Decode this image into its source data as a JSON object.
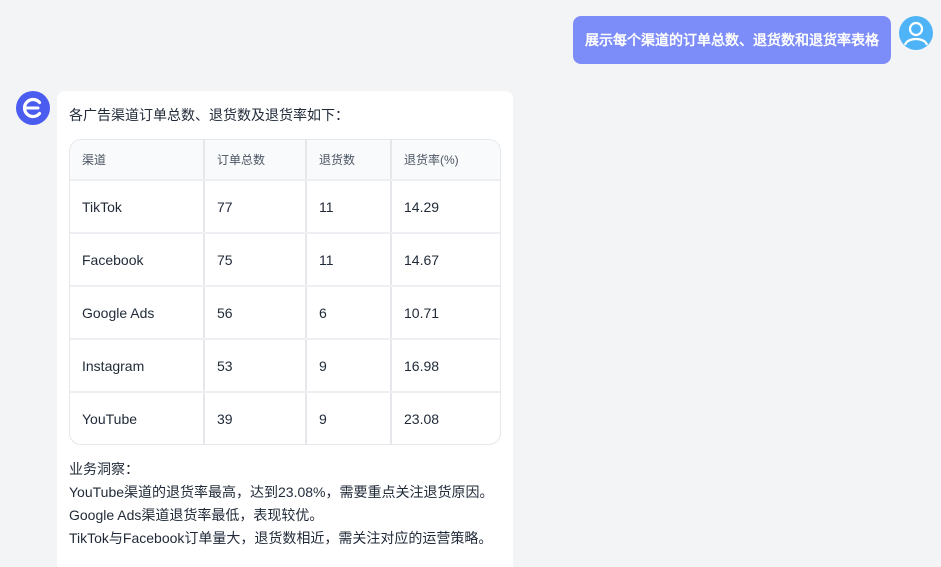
{
  "user_message": {
    "text": "展示每个渠道的订单总数、退货数和退货率表格"
  },
  "bot_message": {
    "intro": "各广告渠道订单总数、退货数及退货率如下：",
    "table": {
      "headers": [
        "渠道",
        "订单总数",
        "退货数",
        "退货率(%)"
      ],
      "rows": [
        [
          "TikTok",
          "77",
          "11",
          "14.29"
        ],
        [
          "Facebook",
          "75",
          "11",
          "14.67"
        ],
        [
          "Google Ads",
          "56",
          "6",
          "10.71"
        ],
        [
          "Instagram",
          "53",
          "9",
          "16.98"
        ],
        [
          "YouTube",
          "39",
          "9",
          "23.08"
        ]
      ]
    },
    "insights": {
      "title": "业务洞察：",
      "lines": [
        "YouTube渠道的退货率最高，达到23.08%，需要重点关注退货原因。",
        "Google Ads渠道退货率最低，表现较优。",
        "TikTok与Facebook订单量大，退货数相近，需关注对应的运营策略。"
      ]
    }
  },
  "icons": {
    "user_avatar": "user-avatar-icon",
    "bot_avatar": "bot-logo-icon"
  },
  "colors": {
    "user_bubble": "#7c8cf8",
    "user_avatar": "#4fb4f7",
    "bot_avatar": "#4b5cf0",
    "background": "#f3f4f6"
  }
}
